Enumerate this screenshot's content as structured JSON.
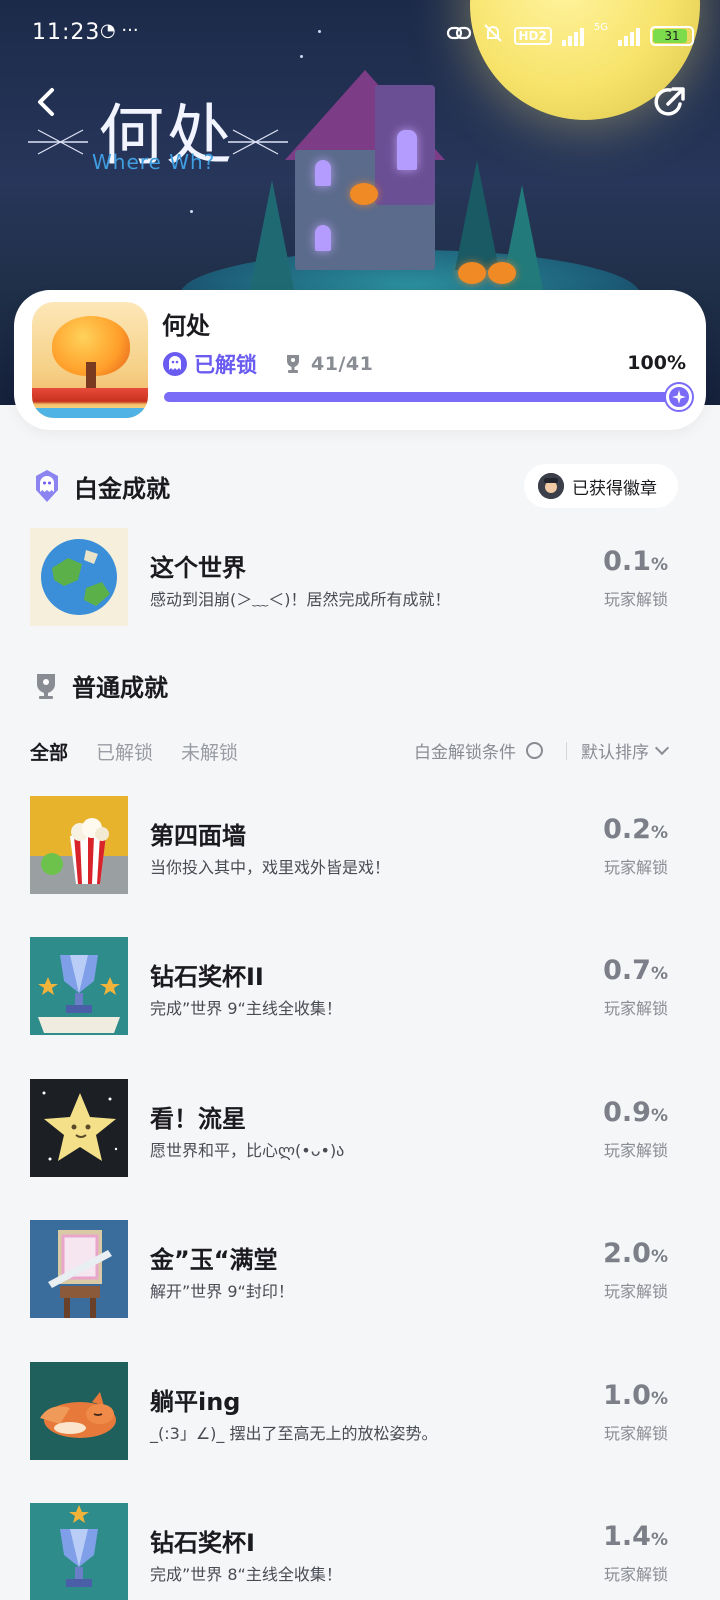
{
  "status_bar": {
    "time": "11:23",
    "extra": "◔ ···",
    "hd_badge": "HD2",
    "network": "5G",
    "battery": "31"
  },
  "header": {
    "logo_cn": "何处",
    "logo_en": "Where Wh?"
  },
  "game": {
    "title": "何处",
    "unlocked_label": "已解锁",
    "count": "41/41",
    "percent": "100%",
    "progress": 1.0,
    "accent_color": "#7a6cf6"
  },
  "platinum": {
    "section_title": "白金成就",
    "badge_button": "已获得徽章",
    "item": {
      "title": "这个世界",
      "desc": "感动到泪崩(＞﹏＜)！居然完成所有成就！",
      "pct": "0.1",
      "pct_unit": "%",
      "players": "玩家解锁"
    }
  },
  "normal": {
    "section_title": "普通成就",
    "tabs": [
      "全部",
      "已解锁",
      "未解锁"
    ],
    "condition_label": "白金解锁条件",
    "sort_label": "默认排序",
    "items": [
      {
        "title": "第四面墙",
        "desc": "当你投入其中，戏里戏外皆是戏！",
        "pct": "0.2",
        "pct_unit": "%",
        "players": "玩家解锁"
      },
      {
        "title": "钻石奖杯II",
        "desc": "完成”世界 9“主线全收集！",
        "pct": "0.7",
        "pct_unit": "%",
        "players": "玩家解锁"
      },
      {
        "title": "看！流星",
        "desc": "愿世界和平，比心ლ(•ᴗ•)ა",
        "pct": "0.9",
        "pct_unit": "%",
        "players": "玩家解锁"
      },
      {
        "title": "金”玉“满堂",
        "desc": "解开”世界 9“封印！",
        "pct": "2.0",
        "pct_unit": "%",
        "players": "玩家解锁"
      },
      {
        "title": "躺平ing",
        "desc": "_(:3」∠)_ 摆出了至高无上的放松姿势。",
        "pct": "1.0",
        "pct_unit": "%",
        "players": "玩家解锁"
      },
      {
        "title": "钻石奖杯I",
        "desc": "完成”世界 8“主线全收集！",
        "pct": "1.4",
        "pct_unit": "%",
        "players": "玩家解锁"
      }
    ]
  }
}
